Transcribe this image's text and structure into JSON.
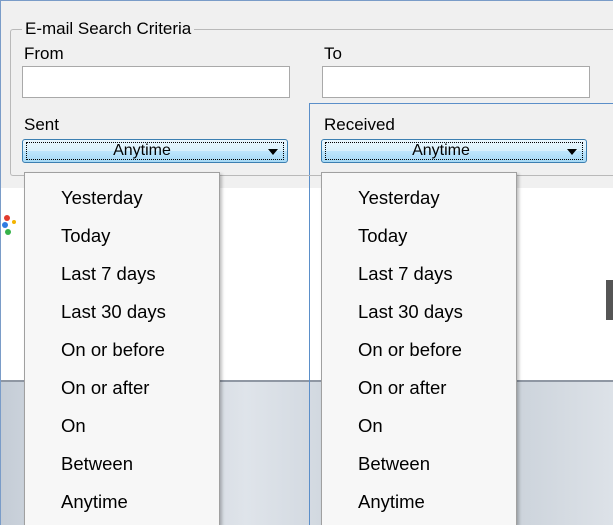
{
  "group": {
    "title": "E-mail Search Criteria"
  },
  "fields": {
    "from_label": "From",
    "to_label": "To",
    "from_value": "",
    "to_value": ""
  },
  "sent": {
    "label": "Sent",
    "value": "Anytime"
  },
  "received": {
    "label": "Received",
    "value": "Anytime"
  },
  "sent_options": [
    "Yesterday",
    "Today",
    "Last 7 days",
    "Last 30 days",
    "On or before",
    "On or after",
    "On",
    "Between",
    "Anytime"
  ],
  "received_options": [
    "Yesterday",
    "Today",
    "Last 7 days",
    "Last 30 days",
    "On or before",
    "On or after",
    "On",
    "Between",
    "Anytime"
  ]
}
